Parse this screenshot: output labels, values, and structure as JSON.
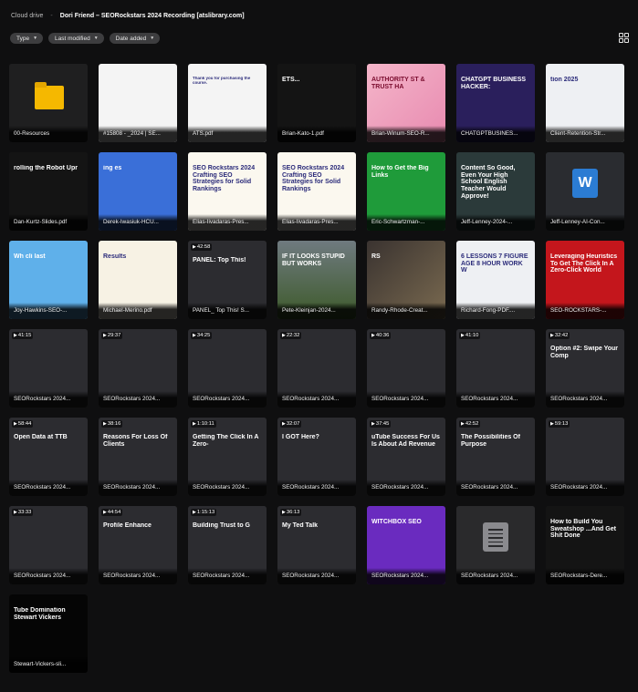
{
  "breadcrumb": {
    "root": "Cloud drive",
    "separator": "-",
    "current": "Dori Friend – SEORockstars 2024 Recording [atslibrary.com]"
  },
  "filters": [
    {
      "label": "Type"
    },
    {
      "label": "Last modified"
    },
    {
      "label": "Date added"
    }
  ],
  "files": [
    {
      "name": "00-Resources",
      "kind": "folder"
    },
    {
      "name": "#15808 - _2024 | SE...",
      "kind": "doc",
      "thumb_text": ""
    },
    {
      "name": "ATS.pdf",
      "kind": "doc",
      "thumb_text": "Thank you for purchasing the course."
    },
    {
      "name": "Brian-Kato-1.pdf",
      "kind": "dark",
      "thumb_text": "ETS..."
    },
    {
      "name": "Brian-Winum-SEO-R...",
      "kind": "pink",
      "thumb_text": "AUTHORITY ST & TRUST HA"
    },
    {
      "name": "CHATGPTBUSINES...",
      "kind": "purple",
      "thumb_text": "CHATGPT BUSINESS HACKER:"
    },
    {
      "name": "Client-Retention-Str...",
      "kind": "light",
      "thumb_text": "tion 2025"
    },
    {
      "name": "Dan-Kurtz-Slides.pdf",
      "kind": "dark",
      "thumb_text": "rolling the Robot Upr"
    },
    {
      "name": "Derek-Iwasiuk-HCU...",
      "kind": "blue",
      "thumb_text": "ing es"
    },
    {
      "name": "Elias-Iivadaras-Pres...",
      "kind": "cream",
      "thumb_text": "SEO Rockstars 2024 Crafting SEO Strategies for Solid Rankings"
    },
    {
      "name": "Elias-Iivadaras-Pres...",
      "kind": "cream",
      "thumb_text": "SEO Rockstars 2024 Crafting SEO Strategies for Solid Rankings"
    },
    {
      "name": "Eric-Schwartzman-...",
      "kind": "green",
      "thumb_text": "How to Get the Big Links"
    },
    {
      "name": "Jeff-Lenney-2024-...",
      "kind": "teal",
      "thumb_text": "Content So Good, Even Your High School English Teacher Would Approve!"
    },
    {
      "name": "Jeff-Lenney-AI-Con...",
      "kind": "word",
      "thumb_text": "W"
    },
    {
      "name": "Joy-Hawkins-SEO-...",
      "kind": "sky",
      "thumb_text": "Wh cli last"
    },
    {
      "name": "Michael-Merino.pdf",
      "kind": "yellow",
      "thumb_text": "Results"
    },
    {
      "name": "PANEL_ Top This! S...",
      "kind": "video",
      "duration": "42:58",
      "thumb_text": "PANEL: Top This!"
    },
    {
      "name": "Pete-Kleinjan-2024...",
      "kind": "photo",
      "thumb_text": "IF IT LOOKS STUPID BUT WORKS"
    },
    {
      "name": "Randy-Rhode-Creat...",
      "kind": "photo2",
      "thumb_text": "RS"
    },
    {
      "name": "Richard-Fong-PDF....",
      "kind": "light",
      "thumb_text": "6 LESSONS 7 FIGURE AGE 8 HOUR WORK W"
    },
    {
      "name": "SEO-ROCKSTARS-...",
      "kind": "red",
      "thumb_text": "Leveraging Heuristics To Get The Click In A Zero-Click World"
    },
    {
      "name": "SEORockstars 2024...",
      "kind": "video",
      "duration": "41:15",
      "thumb_text": ""
    },
    {
      "name": "SEORockstars 2024...",
      "kind": "video",
      "duration": "29:37",
      "thumb_text": ""
    },
    {
      "name": "SEORockstars 2024...",
      "kind": "video",
      "duration": "34:25",
      "thumb_text": ""
    },
    {
      "name": "SEORockstars 2024...",
      "kind": "video",
      "duration": "22:32",
      "thumb_text": ""
    },
    {
      "name": "SEORockstars 2024...",
      "kind": "video",
      "duration": "40:36",
      "thumb_text": ""
    },
    {
      "name": "SEORockstars 2024...",
      "kind": "video",
      "duration": "41:10",
      "thumb_text": ""
    },
    {
      "name": "SEORockstars 2024...",
      "kind": "video",
      "duration": "32:42",
      "thumb_text": "Option #2: Swipe Your Comp"
    },
    {
      "name": "SEORockstars 2024...",
      "kind": "video",
      "duration": "58:44",
      "thumb_text": "Open Data at TTB"
    },
    {
      "name": "SEORockstars 2024...",
      "kind": "video",
      "duration": "38:16",
      "thumb_text": "Reasons For Loss Of Clients"
    },
    {
      "name": "SEORockstars 2024...",
      "kind": "video",
      "duration": "1:10:11",
      "thumb_text": "Getting The Click In A Zero-"
    },
    {
      "name": "SEORockstars 2024...",
      "kind": "video",
      "duration": "32:07",
      "thumb_text": "I GOT Here?"
    },
    {
      "name": "SEORockstars 2024...",
      "kind": "video",
      "duration": "37:45",
      "thumb_text": "uTube Success For Us Is About Ad Revenue"
    },
    {
      "name": "SEORockstars 2024...",
      "kind": "video",
      "duration": "42:52",
      "thumb_text": "The Possibilities Of Purpose"
    },
    {
      "name": "SEORockstars 2024...",
      "kind": "video",
      "duration": "59:13",
      "thumb_text": ""
    },
    {
      "name": "SEORockstars 2024...",
      "kind": "video",
      "duration": "33:33",
      "thumb_text": ""
    },
    {
      "name": "SEORockstars 2024...",
      "kind": "video",
      "duration": "44:54",
      "thumb_text": "Profile Enhance"
    },
    {
      "name": "SEORockstars 2024...",
      "kind": "video",
      "duration": "1:15:13",
      "thumb_text": "Building Trust to G"
    },
    {
      "name": "SEORockstars 2024...",
      "kind": "video",
      "duration": "36:13",
      "thumb_text": "My Ted Talk"
    },
    {
      "name": "SEORockstars 2024...",
      "kind": "purple2",
      "thumb_text": "WITCHBOX SEO"
    },
    {
      "name": "SEORockstars 2024...",
      "kind": "generic",
      "thumb_text": ""
    },
    {
      "name": "SEORockstars-Dere...",
      "kind": "dark",
      "thumb_text": "How to Build You Sweatshop ...And Get Shit Done"
    },
    {
      "name": "Stewart-Vickers-sli...",
      "kind": "black",
      "thumb_text": "Tube Domination Stewart Vickers"
    }
  ]
}
